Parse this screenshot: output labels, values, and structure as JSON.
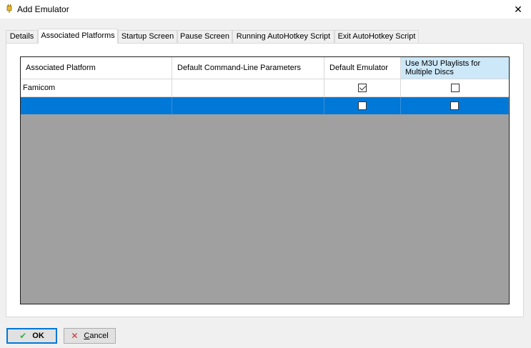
{
  "window": {
    "title": "Add Emulator",
    "close_glyph": "✕",
    "icon": "plugin-icon"
  },
  "tabs": [
    {
      "label": "Details"
    },
    {
      "label": "Associated Platforms",
      "active": true
    },
    {
      "label": "Startup Screen"
    },
    {
      "label": "Pause Screen"
    },
    {
      "label": "Running AutoHotkey Script"
    },
    {
      "label": "Exit AutoHotkey Script"
    }
  ],
  "grid": {
    "columns": [
      "Associated Platform",
      "Default Command-Line Parameters",
      "Default Emulator",
      "Use M3U Playlists for Multiple Discs"
    ],
    "rows": [
      {
        "platform": "Famicom",
        "params": "",
        "default_emulator": true,
        "m3u": false
      },
      {
        "platform": "",
        "params": "",
        "default_emulator": false,
        "m3u": false,
        "selected": true
      }
    ]
  },
  "buttons": {
    "ok_label": "OK",
    "ok_icon": "check-icon",
    "cancel_label": "Cancel",
    "cancel_icon": "x-icon"
  },
  "colors": {
    "selection": "#0078d7",
    "header_selected": "#cce8f9",
    "grid_empty": "#a0a0a0"
  }
}
